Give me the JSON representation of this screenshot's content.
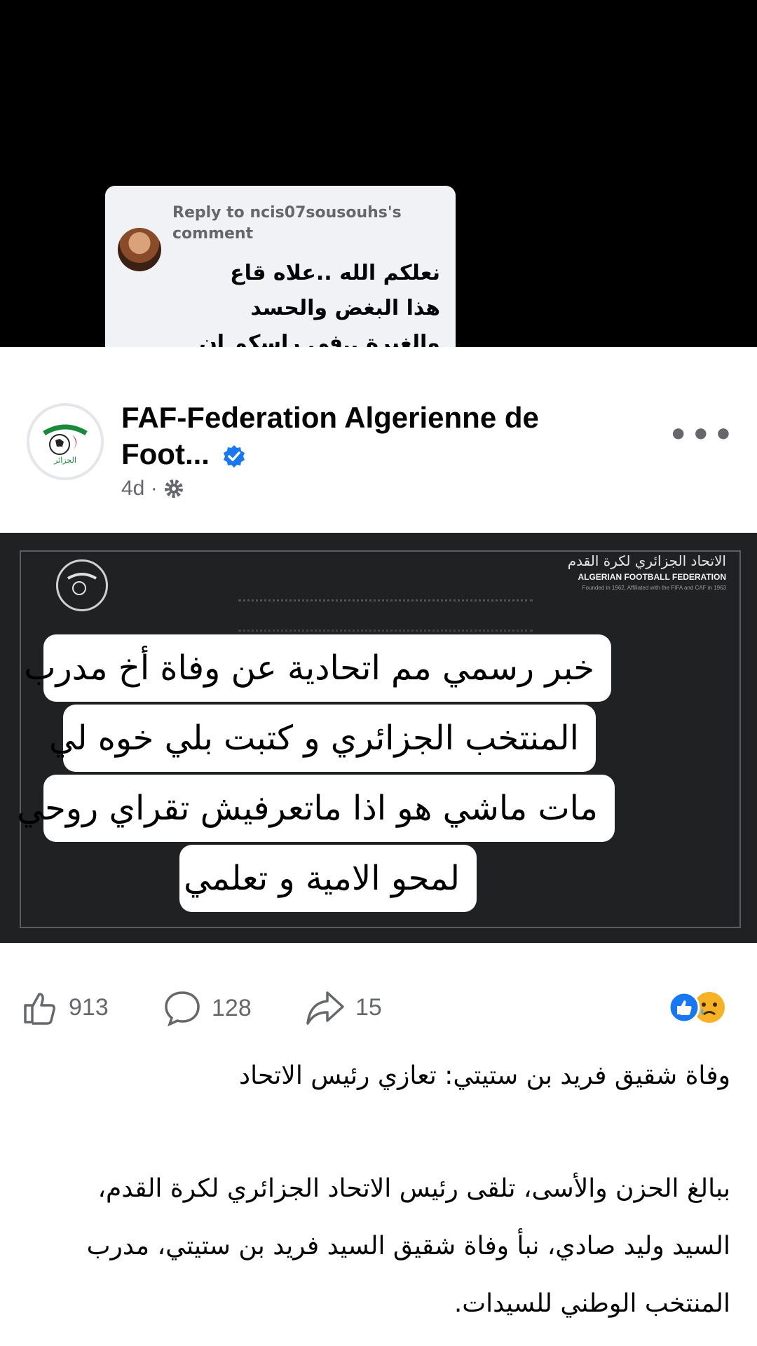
{
  "reply": {
    "header": "Reply to ncis07sousouhs's comment",
    "text": "نعلكم الله ..علاه قاع\nهذا البغض والحسد\nوالغيرة ..في راسكم ان\nشاءالله 🤲"
  },
  "post": {
    "page_name": "FAF-Federation Algerienne de Foot...",
    "time": "4d ·",
    "media": {
      "fed_ar": "الاتحاد الجزائري لكرة القدم",
      "fed_en": "ALGERIAN FOOTBALL FEDERATION",
      "fed_sub": "Founded in 1962, Affiliated with the FIFA and CAF in 1963",
      "overlay_lines": [
        "خبر رسمي مم اتحادية عن وفاة أخ مدرب",
        "المنتخب الجزائري و كتبت بلي خوه لي",
        "مات ماشي هو اذا ماتعرفيش تقراي روحي",
        "لمحو الامية و تعلمي"
      ]
    },
    "likes": "913",
    "comments": "128",
    "shares": "15",
    "caption_title": "وفاة شقيق فريد بن ستيتي: تعازي رئيس الاتحاد",
    "caption_body": [
      "ببالغ الحزن والأسى، تلقى رئيس الاتحاد الجزائري لكرة القدم،",
      "السيد وليد صادي، نبأ وفاة شقيق السيد فريد بن ستيتي، مدرب",
      "المنتخب الوطني للسيدات."
    ]
  },
  "colors": {
    "verified": "#1877f2",
    "like_reaction": "#1877f2",
    "sad_reaction": "#f7b125",
    "text_secondary": "#65676b"
  },
  "icons": [
    "verified-icon",
    "gear-icon",
    "more-options-icon",
    "like-icon",
    "comment-icon",
    "share-icon",
    "like-reaction-icon",
    "sad-reaction-icon",
    "federation-logo"
  ]
}
